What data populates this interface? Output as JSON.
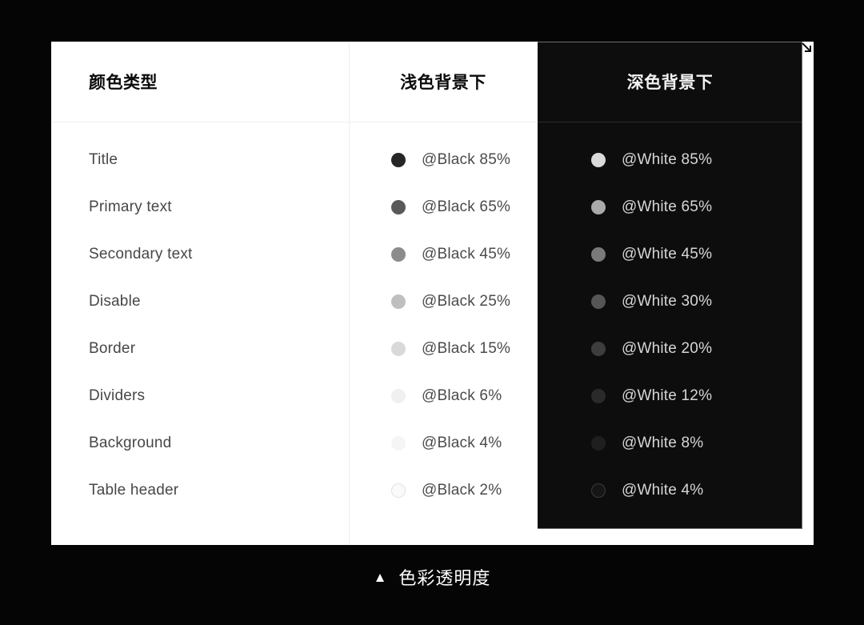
{
  "page": {
    "background_color": "#050505",
    "caption": {
      "marker": "▲",
      "marker_icon": "triangle-up-icon",
      "text": "色彩透明度"
    }
  },
  "card": {
    "background_color": "#ffffff",
    "dark_panel_color": "#0d0d0d",
    "resize_handle_icon": "resize-corner-icon",
    "headers": {
      "type": "颜色类型",
      "light": "浅色背景下",
      "dark": "深色背景下"
    },
    "rows": [
      {
        "type": "Title",
        "light": {
          "token": "@Black 85%",
          "color": "#000000",
          "opacity": 0.85,
          "ring": false
        },
        "dark": {
          "token": "@White 85%",
          "color": "#ffffff",
          "opacity": 0.85,
          "ring": false
        }
      },
      {
        "type": "Primary text",
        "light": {
          "token": "@Black 65%",
          "color": "#000000",
          "opacity": 0.65,
          "ring": false
        },
        "dark": {
          "token": "@White 65%",
          "color": "#ffffff",
          "opacity": 0.65,
          "ring": false
        }
      },
      {
        "type": "Secondary text",
        "light": {
          "token": "@Black 45%",
          "color": "#000000",
          "opacity": 0.45,
          "ring": false
        },
        "dark": {
          "token": "@White 45%",
          "color": "#ffffff",
          "opacity": 0.45,
          "ring": false
        }
      },
      {
        "type": "Disable",
        "light": {
          "token": "@Black 25%",
          "color": "#000000",
          "opacity": 0.25,
          "ring": false
        },
        "dark": {
          "token": "@White 30%",
          "color": "#ffffff",
          "opacity": 0.3,
          "ring": false
        }
      },
      {
        "type": "Border",
        "light": {
          "token": "@Black 15%",
          "color": "#000000",
          "opacity": 0.15,
          "ring": false
        },
        "dark": {
          "token": "@White 20%",
          "color": "#ffffff",
          "opacity": 0.2,
          "ring": false
        }
      },
      {
        "type": "Dividers",
        "light": {
          "token": "@Black 6%",
          "color": "#000000",
          "opacity": 0.06,
          "ring": false
        },
        "dark": {
          "token": "@White 12%",
          "color": "#ffffff",
          "opacity": 0.12,
          "ring": false
        }
      },
      {
        "type": "Background",
        "light": {
          "token": "@Black 4%",
          "color": "#000000",
          "opacity": 0.04,
          "ring": false
        },
        "dark": {
          "token": "@White 8%",
          "color": "#ffffff",
          "opacity": 0.08,
          "ring": false
        }
      },
      {
        "type": "Table header",
        "light": {
          "token": "@Black 2%",
          "color": "#000000",
          "opacity": 0.02,
          "ring": true
        },
        "dark": {
          "token": "@White 4%",
          "color": "#ffffff",
          "opacity": 0.04,
          "ring": true
        }
      }
    ]
  }
}
